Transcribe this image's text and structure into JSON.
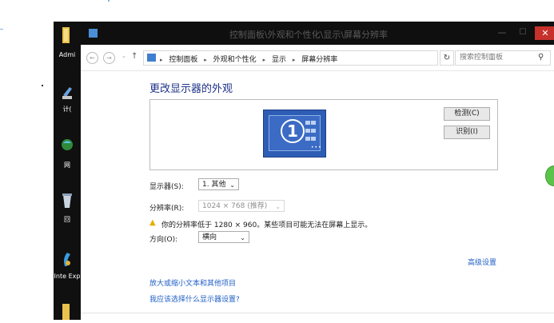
{
  "window": {
    "title": "控制面板\\外观和个性化\\显示\\屏幕分辨率",
    "min_glyph": "—",
    "max_glyph": "☐",
    "close_glyph": "✕"
  },
  "nav": {
    "back_glyph": "←",
    "forward_glyph": "→",
    "recent_glyph": "⌄",
    "up_glyph": "↑",
    "breadcrumbs": [
      "控制面板",
      "外观和个性化",
      "显示",
      "屏幕分辨率"
    ],
    "separator_glyph": "▸",
    "dropdown_glyph": "⌄",
    "refresh_glyph": "↻",
    "search_placeholder": "搜索控制面板",
    "search_glyph": "⚲"
  },
  "desktop": {
    "icons": [
      {
        "label": "Admi"
      },
      {
        "label": "计("
      },
      {
        "label": "网"
      },
      {
        "label": "回"
      },
      {
        "label": "Inte Exp"
      }
    ]
  },
  "content": {
    "heading": "更改显示器的外观",
    "monitor_number": "1",
    "monitor_dots": "•••",
    "detect_button": "检测(C)",
    "identify_button": "识别(I)",
    "display_label": "显示器(S):",
    "display_value": "1. 其他",
    "resolution_label": "分辨率(R):",
    "resolution_value": "1024 × 768 (推荐)",
    "warning_glyph": "▲",
    "warning_text": "你的分辨率低于 1280 × 960。某些项目可能无法在屏幕上显示。",
    "orientation_label": "方向(O):",
    "orientation_value": "横向",
    "select_arrow": "⌄",
    "advanced_link": "高级设置",
    "text_size_link": "放大或缩小文本和其他项目",
    "which_settings_link": "我应该选择什么显示器设置?"
  },
  "colors": {
    "titlebar": "#0f0f0f",
    "close": "#c7312c",
    "link": "#1f5fc5",
    "heading": "#1e3287",
    "monitor": "#2d5db4"
  }
}
